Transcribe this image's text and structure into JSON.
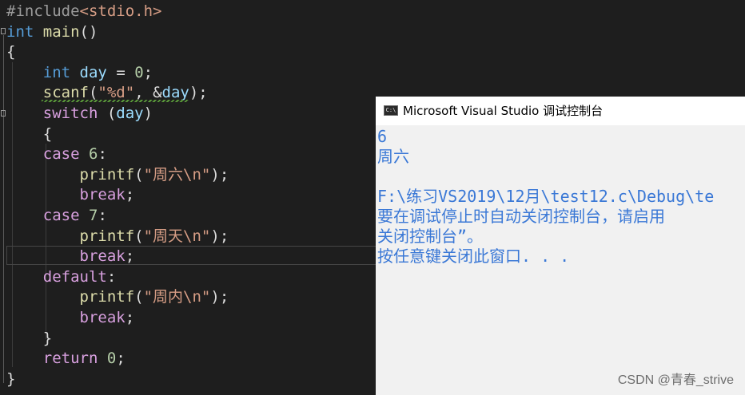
{
  "colors": {
    "editor_bg": "#1e1e1e",
    "keyword": "#569cd6",
    "function": "#dcdcaa",
    "string": "#d69d85",
    "number": "#b5cea8",
    "preprocessor": "#9b9b9b",
    "variable": "#9cdcfe",
    "control_keyword": "#d8a0df",
    "console_bg": "#f1f1f1",
    "console_text": "#3a78d6"
  },
  "editor": {
    "lines": [
      {
        "tokens": [
          {
            "t": "#include",
            "c": "preprocessor"
          },
          {
            "t": "<stdio.h>",
            "c": "string"
          }
        ]
      },
      {
        "tokens": [
          {
            "t": "int",
            "c": "keyword"
          },
          {
            "t": " "
          },
          {
            "t": "main",
            "c": "function"
          },
          {
            "t": "()"
          }
        ]
      },
      {
        "tokens": [
          {
            "t": "{"
          }
        ]
      },
      {
        "tokens": [
          {
            "t": "    "
          },
          {
            "t": "int",
            "c": "keyword"
          },
          {
            "t": " "
          },
          {
            "t": "day",
            "c": "variable"
          },
          {
            "t": " = "
          },
          {
            "t": "0",
            "c": "number"
          },
          {
            "t": ";"
          }
        ]
      },
      {
        "tokens": [
          {
            "t": "    "
          },
          {
            "t": "scanf",
            "c": "function"
          },
          {
            "t": "("
          },
          {
            "t": "\"%d\"",
            "c": "string"
          },
          {
            "t": ", &"
          },
          {
            "t": "day",
            "c": "variable"
          },
          {
            "t": ");"
          }
        ]
      },
      {
        "tokens": [
          {
            "t": "    "
          },
          {
            "t": "switch",
            "c": "control_keyword"
          },
          {
            "t": " ("
          },
          {
            "t": "day",
            "c": "variable"
          },
          {
            "t": ")"
          }
        ]
      },
      {
        "tokens": [
          {
            "t": "    {"
          }
        ]
      },
      {
        "tokens": [
          {
            "t": "    "
          },
          {
            "t": "case",
            "c": "control_keyword"
          },
          {
            "t": " "
          },
          {
            "t": "6",
            "c": "number"
          },
          {
            "t": ":"
          }
        ]
      },
      {
        "tokens": [
          {
            "t": "        "
          },
          {
            "t": "printf",
            "c": "function"
          },
          {
            "t": "("
          },
          {
            "t": "\"周六\\n\"",
            "c": "string"
          },
          {
            "t": ");"
          }
        ]
      },
      {
        "tokens": [
          {
            "t": "        "
          },
          {
            "t": "break",
            "c": "control_keyword"
          },
          {
            "t": ";"
          }
        ]
      },
      {
        "tokens": [
          {
            "t": "    "
          },
          {
            "t": "case",
            "c": "control_keyword"
          },
          {
            "t": " "
          },
          {
            "t": "7",
            "c": "number"
          },
          {
            "t": ":"
          }
        ]
      },
      {
        "tokens": [
          {
            "t": "        "
          },
          {
            "t": "printf",
            "c": "function"
          },
          {
            "t": "("
          },
          {
            "t": "\"周天\\n\"",
            "c": "string"
          },
          {
            "t": ");"
          }
        ]
      },
      {
        "tokens": [
          {
            "t": "        "
          },
          {
            "t": "break",
            "c": "control_keyword"
          },
          {
            "t": ";"
          }
        ]
      },
      {
        "tokens": [
          {
            "t": "    "
          },
          {
            "t": "default",
            "c": "control_keyword"
          },
          {
            "t": ":"
          }
        ]
      },
      {
        "tokens": [
          {
            "t": "        "
          },
          {
            "t": "printf",
            "c": "function"
          },
          {
            "t": "("
          },
          {
            "t": "\"周内\\n\"",
            "c": "string"
          },
          {
            "t": ");"
          }
        ]
      },
      {
        "tokens": [
          {
            "t": "        "
          },
          {
            "t": "break",
            "c": "control_keyword"
          },
          {
            "t": ";"
          }
        ]
      },
      {
        "tokens": [
          {
            "t": "    }"
          }
        ]
      },
      {
        "tokens": [
          {
            "t": "    "
          },
          {
            "t": "return",
            "c": "control_keyword"
          },
          {
            "t": " "
          },
          {
            "t": "0",
            "c": "number"
          },
          {
            "t": ";"
          }
        ]
      },
      {
        "tokens": [
          {
            "t": "}"
          }
        ]
      }
    ]
  },
  "console": {
    "title": "Microsoft Visual Studio 调试控制台",
    "icon": "console-app-icon",
    "icon_text": "C:\\",
    "output_lines": [
      "6",
      "周六",
      "",
      "F:\\练习VS2019\\12月\\test12.c\\Debug\\te",
      "要在调试停止时自动关闭控制台，请启用",
      "关闭控制台”。",
      "按任意键关闭此窗口. . ."
    ]
  },
  "watermark": "CSDN @青春_strive"
}
